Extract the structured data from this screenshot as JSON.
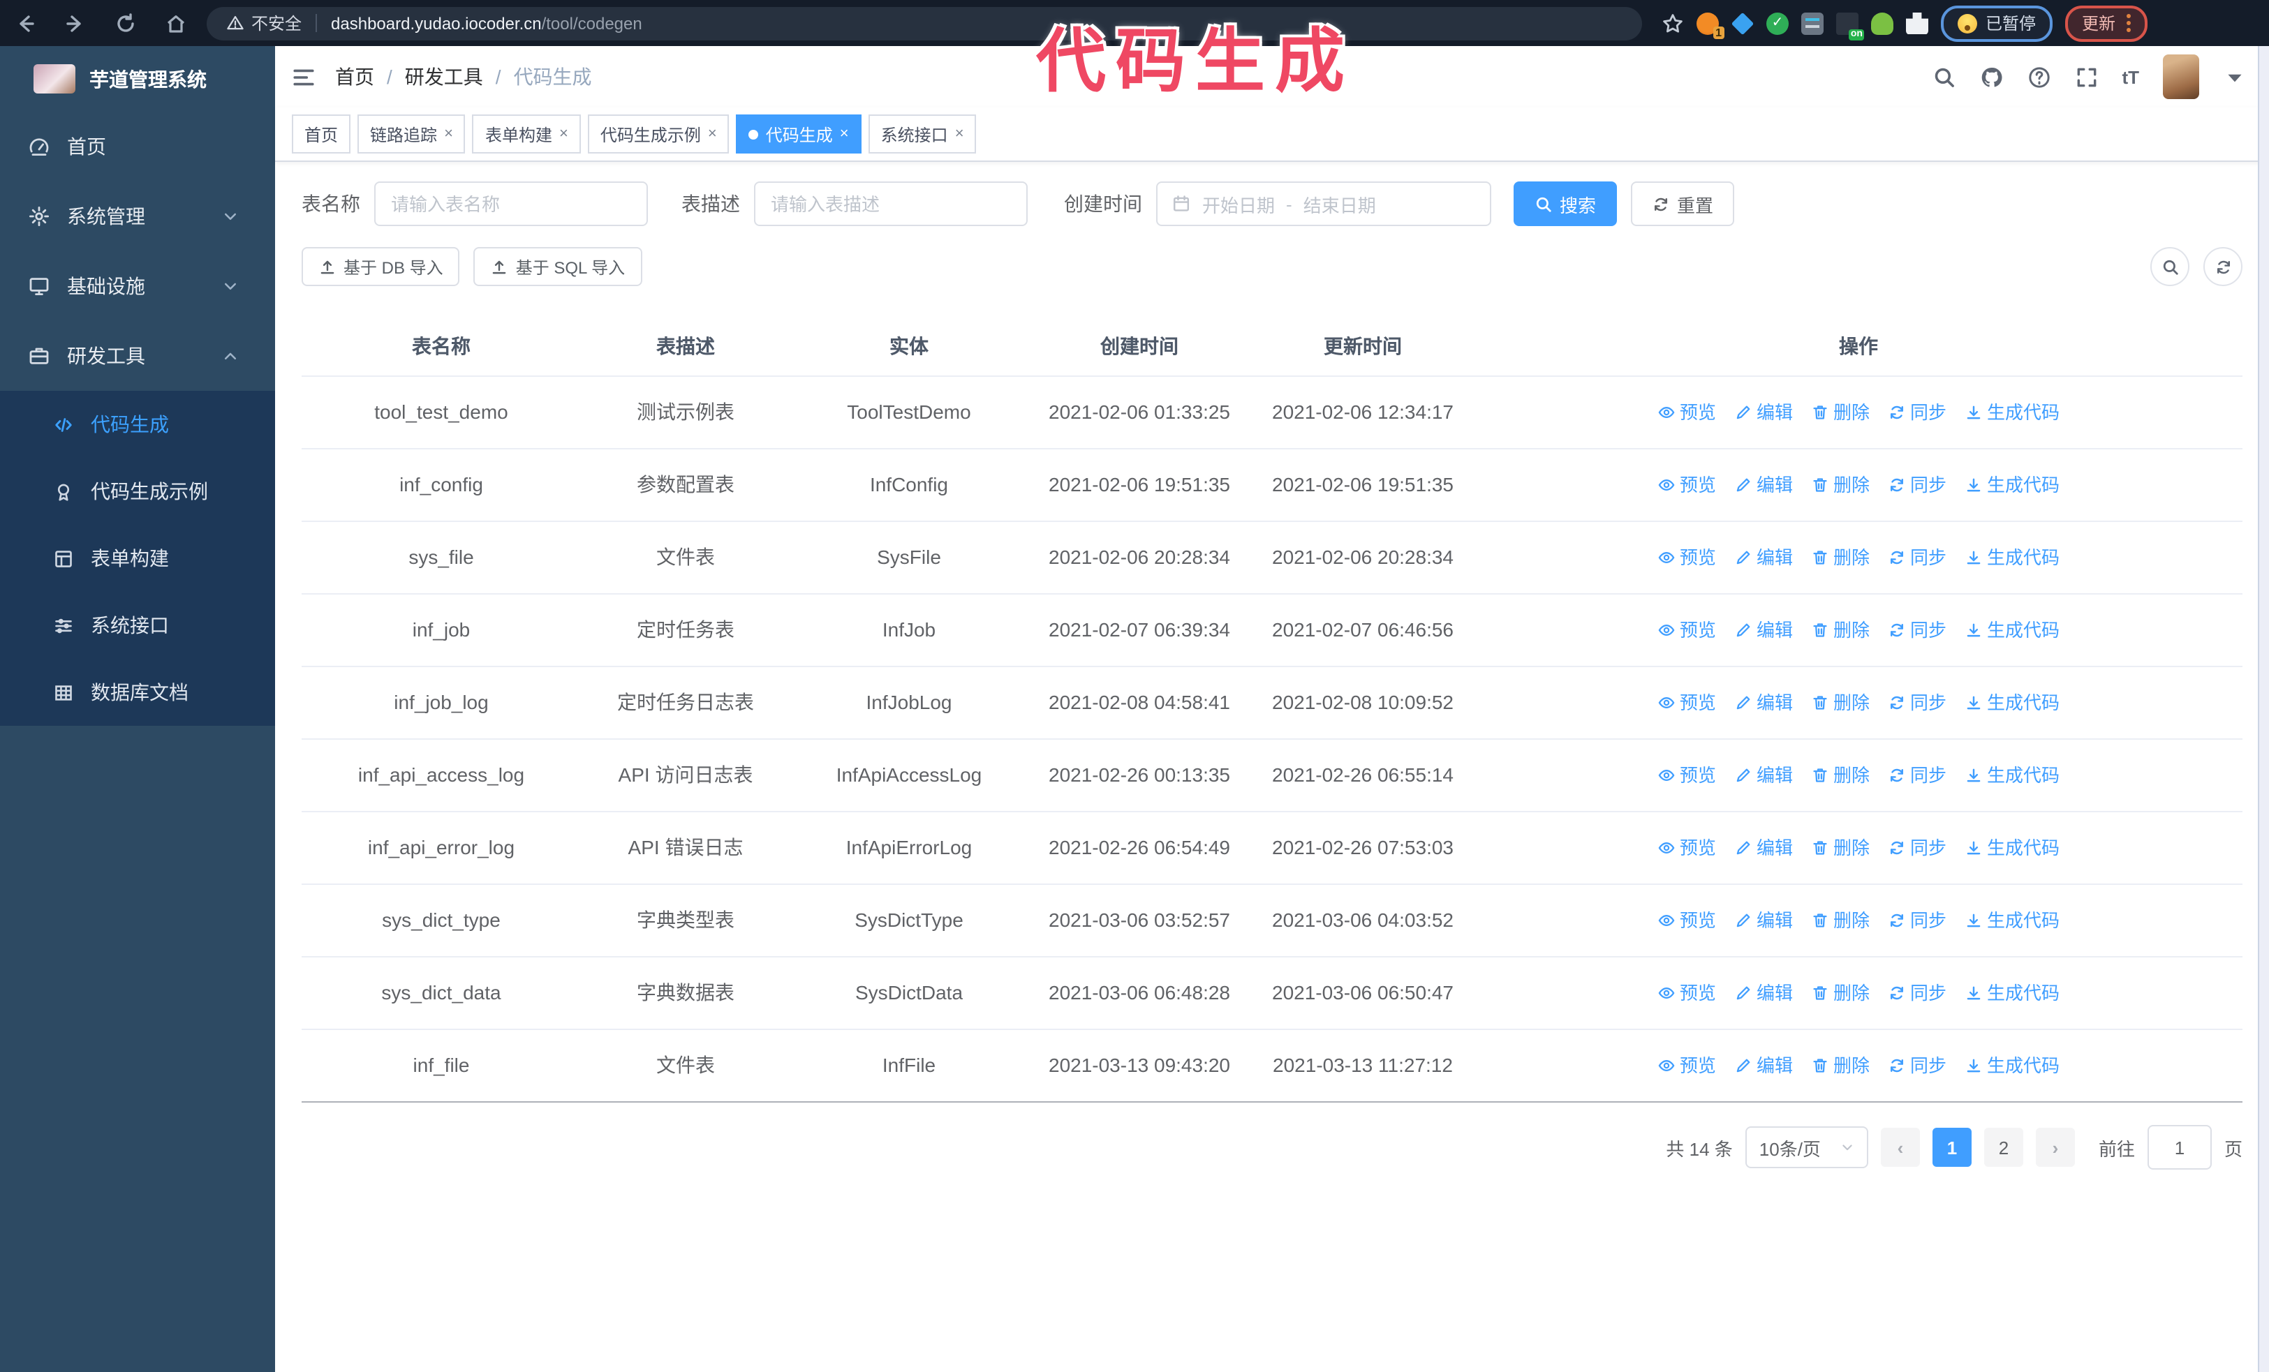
{
  "browser": {
    "security_warning": "不安全",
    "url_host": "dashboard.yudao.iocoder.cn",
    "url_path": "/tool/codegen",
    "extension_badge": "1",
    "extension_on_badge": "on",
    "paused_label": "已暂停",
    "update_label": "更新"
  },
  "annotation": {
    "text": "代码生成",
    "color": "#ef4863"
  },
  "app": {
    "title": "芋道管理系统"
  },
  "breadcrumb": {
    "items": [
      "首页",
      "研发工具",
      "代码生成"
    ]
  },
  "tabs": [
    {
      "label": "首页",
      "closable": false,
      "active": false
    },
    {
      "label": "链路追踪",
      "closable": true,
      "active": false
    },
    {
      "label": "表单构建",
      "closable": true,
      "active": false
    },
    {
      "label": "代码生成示例",
      "closable": true,
      "active": false
    },
    {
      "label": "代码生成",
      "closable": true,
      "active": true
    },
    {
      "label": "系统接口",
      "closable": true,
      "active": false
    }
  ],
  "sidebar": {
    "items": [
      {
        "label": "首页",
        "icon": "dashboard-icon"
      },
      {
        "label": "系统管理",
        "icon": "gear-icon",
        "chevron": "down"
      },
      {
        "label": "基础设施",
        "icon": "monitor-icon",
        "chevron": "down"
      },
      {
        "label": "研发工具",
        "icon": "briefcase-icon",
        "chevron": "up",
        "expanded": true,
        "children": [
          {
            "label": "代码生成",
            "icon": "code-icon",
            "active": true
          },
          {
            "label": "代码生成示例",
            "icon": "medal-icon",
            "active": false
          },
          {
            "label": "表单构建",
            "icon": "form-icon",
            "active": false
          },
          {
            "label": "系统接口",
            "icon": "api-icon",
            "active": false
          },
          {
            "label": "数据库文档",
            "icon": "database-doc-icon",
            "active": false
          }
        ]
      }
    ]
  },
  "search_form": {
    "name_label": "表名称",
    "name_placeholder": "请输入表名称",
    "desc_label": "表描述",
    "desc_placeholder": "请输入表描述",
    "date_label": "创建时间",
    "date_start_placeholder": "开始日期",
    "date_separator": "-",
    "date_end_placeholder": "结束日期",
    "search_label": "搜索",
    "reset_label": "重置"
  },
  "toolbar": {
    "import_db_label": "基于 DB 导入",
    "import_sql_label": "基于 SQL 导入"
  },
  "table": {
    "headers": [
      "表名称",
      "表描述",
      "实体",
      "创建时间",
      "更新时间",
      "操作"
    ],
    "actions": [
      "预览",
      "编辑",
      "删除",
      "同步",
      "生成代码"
    ],
    "action_icons": [
      "eye-icon",
      "edit-icon",
      "delete-icon",
      "sync-icon",
      "download-icon"
    ],
    "rows": [
      {
        "name": "tool_test_demo",
        "desc": "测试示例表",
        "entity": "ToolTestDemo",
        "created": "2021-02-06 01:33:25",
        "updated": "2021-02-06 12:34:17"
      },
      {
        "name": "inf_config",
        "desc": "参数配置表",
        "entity": "InfConfig",
        "created": "2021-02-06 19:51:35",
        "updated": "2021-02-06 19:51:35"
      },
      {
        "name": "sys_file",
        "desc": "文件表",
        "entity": "SysFile",
        "created": "2021-02-06 20:28:34",
        "updated": "2021-02-06 20:28:34"
      },
      {
        "name": "inf_job",
        "desc": "定时任务表",
        "entity": "InfJob",
        "created": "2021-02-07 06:39:34",
        "updated": "2021-02-07 06:46:56"
      },
      {
        "name": "inf_job_log",
        "desc": "定时任务日志表",
        "entity": "InfJobLog",
        "created": "2021-02-08 04:58:41",
        "updated": "2021-02-08 10:09:52"
      },
      {
        "name": "inf_api_access_log",
        "desc": "API 访问日志表",
        "entity": "InfApiAccessLog",
        "created": "2021-02-26 00:13:35",
        "updated": "2021-02-26 06:55:14"
      },
      {
        "name": "inf_api_error_log",
        "desc": "API 错误日志",
        "entity": "InfApiErrorLog",
        "created": "2021-02-26 06:54:49",
        "updated": "2021-02-26 07:53:03"
      },
      {
        "name": "sys_dict_type",
        "desc": "字典类型表",
        "entity": "SysDictType",
        "created": "2021-03-06 03:52:57",
        "updated": "2021-03-06 04:03:52"
      },
      {
        "name": "sys_dict_data",
        "desc": "字典数据表",
        "entity": "SysDictData",
        "created": "2021-03-06 06:48:28",
        "updated": "2021-03-06 06:50:47"
      },
      {
        "name": "inf_file",
        "desc": "文件表",
        "entity": "InfFile",
        "created": "2021-03-13 09:43:20",
        "updated": "2021-03-13 11:27:12"
      }
    ]
  },
  "pagination": {
    "total_label": "共 14 条",
    "page_size_label": "10条/页",
    "pages": [
      "1",
      "2"
    ],
    "active_page": "1",
    "goto_label": "前往",
    "goto_value": "1",
    "page_suffix": "页"
  },
  "colors": {
    "primary": "#409eff",
    "annotation": "#ef4863",
    "sidebar_bg": "#2d4a63",
    "submenu_bg": "#1d3858"
  }
}
